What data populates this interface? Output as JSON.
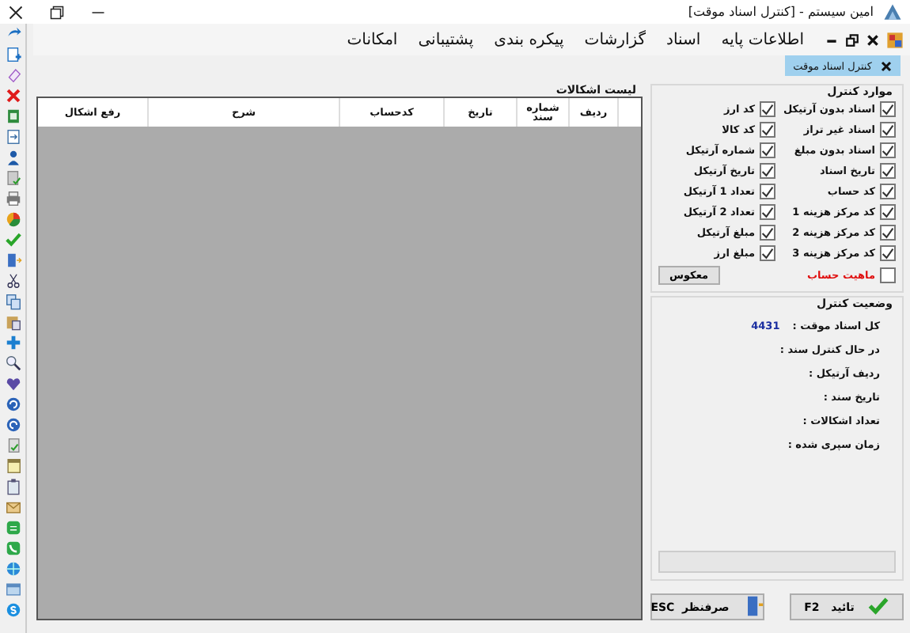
{
  "window": {
    "title": "امین سیستم - [کنترل اسناد موقت]"
  },
  "menu": [
    "اطلاعات پایه",
    "اسناد",
    "گزارشات",
    "پیکره بندی",
    "پشتیبانی",
    "امکانات"
  ],
  "tabs": [
    {
      "label": "کنترل اسناد موقت",
      "selected": true
    }
  ],
  "errors_list": {
    "title": "لیست اشکالات",
    "columns": [
      "",
      "ردیف",
      "شماره سند",
      "تاریخ",
      "کدحساب",
      "شرح",
      "رفع اشکال"
    ]
  },
  "control_items": {
    "title": "موارد کنترل",
    "checks": [
      {
        "label": "اسناد بدون آرتیکل",
        "checked": true
      },
      {
        "label": "کد ارز",
        "checked": true
      },
      {
        "label": "اسناد غیر تراز",
        "checked": true
      },
      {
        "label": "کد کالا",
        "checked": true
      },
      {
        "label": "اسناد بدون مبلغ",
        "checked": true
      },
      {
        "label": "شماره آرتیکل",
        "checked": true
      },
      {
        "label": "تاریخ اسناد",
        "checked": true
      },
      {
        "label": "تاریخ آرتیکل",
        "checked": true
      },
      {
        "label": "کد حساب",
        "checked": true
      },
      {
        "label": "تعداد 1 آرتیکل",
        "checked": true
      },
      {
        "label": "کد مرکز هزینه 1",
        "checked": true
      },
      {
        "label": "تعداد 2 آرتیکل",
        "checked": true
      },
      {
        "label": "کد مرکز هزینه 2",
        "checked": true
      },
      {
        "label": "مبلغ آرتیکل",
        "checked": true
      },
      {
        "label": "کد مرکز هزینه 3",
        "checked": true
      },
      {
        "label": "مبلغ ارز",
        "checked": true
      }
    ],
    "account_nature": {
      "label": "ماهیت حساب",
      "checked": false
    },
    "invert_button": "معکوس"
  },
  "control_status": {
    "title": "وضعیت کنترل",
    "fields": [
      {
        "label": "کل اسناد موقت :",
        "value": "4431"
      },
      {
        "label": "در حال کنترل سند :"
      },
      {
        "label": "ردیف آرتیکل :"
      },
      {
        "label": "تاریخ سند :"
      },
      {
        "label": "تعداد اشکالات :"
      },
      {
        "label": "زمان سپری شده :"
      }
    ],
    "progress": {
      "level": 0
    }
  },
  "buttons": [
    {
      "kind": "confirm",
      "label": "تائید   F2"
    },
    {
      "kind": "cancel",
      "label": "صرفنظر  ESC"
    }
  ]
}
